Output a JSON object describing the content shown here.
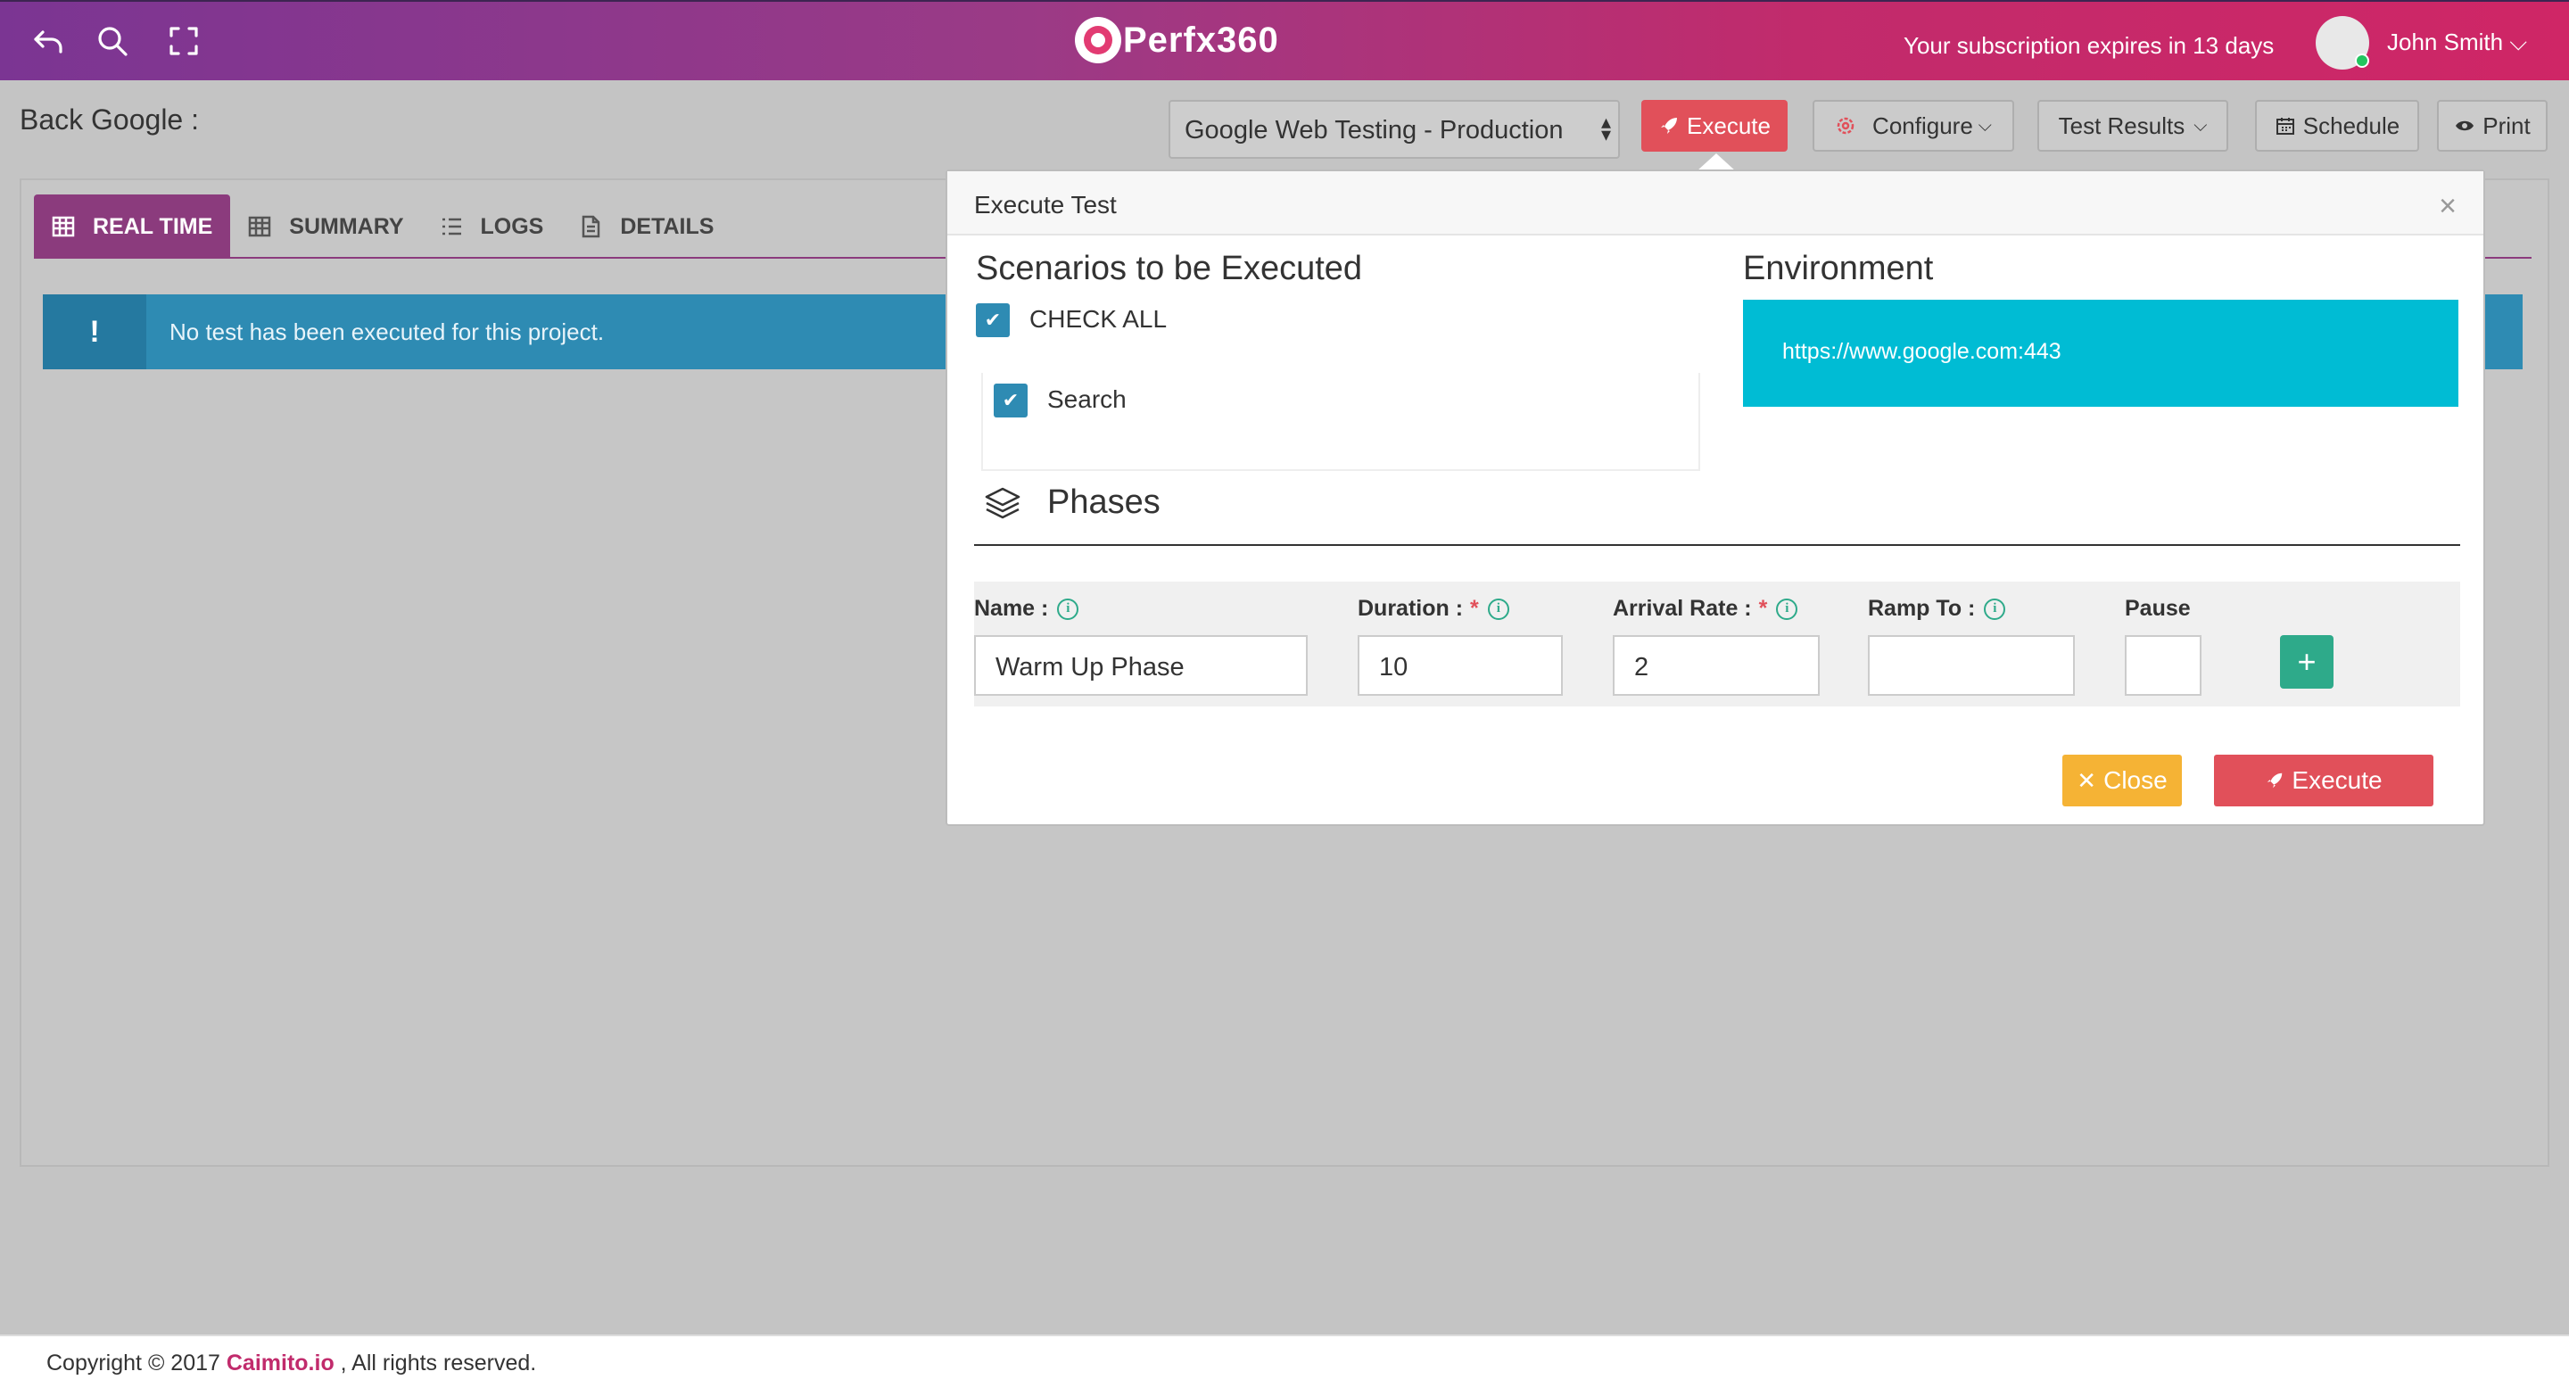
{
  "header": {
    "logo_text": "Perfx360",
    "subscription_text": "Your subscription expires in 13 days",
    "user_name": "John Smith"
  },
  "toolbar": {
    "page_title": "Back Google :",
    "project_select_value": "Google Web Testing - Production",
    "execute_label": "Execute",
    "configure_label": "Configure",
    "test_results_label": "Test Results",
    "schedule_label": "Schedule",
    "print_label": "Print"
  },
  "tabs": [
    {
      "label": "REAL TIME",
      "active": true
    },
    {
      "label": "SUMMARY",
      "active": false
    },
    {
      "label": "LOGS",
      "active": false
    },
    {
      "label": "DETAILS",
      "active": false
    }
  ],
  "alert": {
    "icon": "!",
    "message": "No test has been executed for this project."
  },
  "modal": {
    "title": "Execute Test",
    "close_symbol": "×",
    "scenarios_title": "Scenarios to be Executed",
    "check_all_label": "CHECK ALL",
    "scenarios": [
      {
        "label": "Search",
        "checked": true
      }
    ],
    "environment_title": "Environment",
    "environment_url": "https://www.google.com:443",
    "phases_title": "Phases",
    "fields": {
      "name_label": "Name :",
      "duration_label": "Duration :",
      "arrival_rate_label": "Arrival Rate :",
      "ramp_to_label": "Ramp To :",
      "pause_label": "Pause",
      "required_mark": "*",
      "name_value": "Warm Up Phase",
      "duration_value": "10",
      "arrival_rate_value": "2",
      "ramp_to_value": "",
      "pause_value": ""
    },
    "add_symbol": "+",
    "close_button_label": "Close",
    "execute_button_label": "Execute"
  },
  "footer": {
    "prefix": "Copyright © 2017",
    "brand": "Caimito.io",
    "suffix": ", All rights reserved."
  },
  "colors": {
    "brand_gradient_start": "#7b3593",
    "brand_gradient_end": "#cf2666",
    "execute_red": "#e1505a",
    "info_blue": "#2e8bb3",
    "environment_cyan": "#00bcd4",
    "add_green": "#2eaa8a",
    "close_yellow": "#f5b335"
  }
}
